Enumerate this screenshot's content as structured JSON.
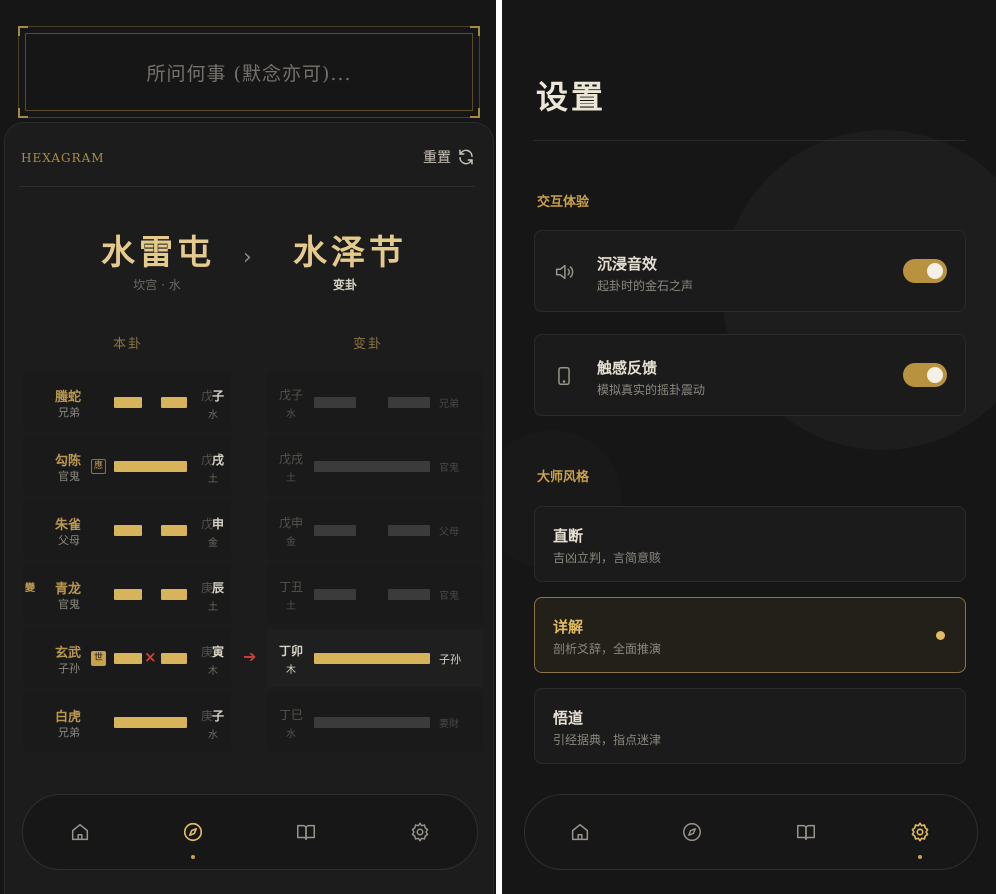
{
  "divination": {
    "question_placeholder": "所问何事 (默念亦可)...",
    "header_label": "HEXAGRAM",
    "reset_label": "重置",
    "original": {
      "name": "水雷屯",
      "palace": "坎宫 · 水",
      "column_title": "本卦"
    },
    "changed": {
      "name": "水泽节",
      "label": "变卦",
      "column_title": "变卦"
    },
    "side_mark": "變",
    "lines": [
      {
        "spirit": "螣蛇",
        "relation": "兄弟",
        "type": "yin",
        "badge": "",
        "naja": "子",
        "naja_prefix": "戊",
        "element": "水",
        "moving": false,
        "changed": {
          "naja": "子",
          "prefix": "戊",
          "element": "水",
          "type": "yin",
          "relation": "兄弟",
          "active": false
        }
      },
      {
        "spirit": "勾陈",
        "relation": "官鬼",
        "type": "yang",
        "badge": "應",
        "naja": "戌",
        "naja_prefix": "戊",
        "element": "土",
        "moving": false,
        "changed": {
          "naja": "戌",
          "prefix": "戊",
          "element": "土",
          "type": "yang",
          "relation": "官鬼",
          "active": false
        }
      },
      {
        "spirit": "朱雀",
        "relation": "父母",
        "type": "yin",
        "badge": "",
        "naja": "申",
        "naja_prefix": "戊",
        "element": "金",
        "moving": false,
        "changed": {
          "naja": "申",
          "prefix": "戊",
          "element": "金",
          "type": "yin",
          "relation": "父母",
          "active": false
        }
      },
      {
        "spirit": "青龙",
        "relation": "官鬼",
        "type": "yin",
        "badge": "",
        "naja": "辰",
        "naja_prefix": "庚",
        "element": "土",
        "moving": false,
        "changed": {
          "naja": "丑",
          "prefix": "丁",
          "element": "土",
          "type": "yin",
          "relation": "官鬼",
          "active": false
        }
      },
      {
        "spirit": "玄武",
        "relation": "子孙",
        "type": "yin",
        "badge": "世",
        "naja": "寅",
        "naja_prefix": "庚",
        "element": "木",
        "moving": true,
        "changed": {
          "naja": "卯",
          "prefix": "丁",
          "element": "木",
          "type": "yang",
          "relation": "子孙",
          "active": true
        }
      },
      {
        "spirit": "白虎",
        "relation": "兄弟",
        "type": "yang",
        "badge": "",
        "naja": "子",
        "naja_prefix": "庚",
        "element": "水",
        "moving": false,
        "changed": {
          "naja": "巳",
          "prefix": "丁",
          "element": "水",
          "type": "yang",
          "relation": "妻財",
          "active": false
        }
      }
    ],
    "nav": [
      {
        "icon": "home-icon",
        "active": false
      },
      {
        "icon": "compass-icon",
        "active": true
      },
      {
        "icon": "book-icon",
        "active": false
      },
      {
        "icon": "gear-icon",
        "active": false
      }
    ]
  },
  "settings": {
    "title": "设置",
    "interaction_section": "交互体验",
    "sound": {
      "title": "沉浸音效",
      "desc": "起卦时的金石之声",
      "enabled": true,
      "icon": "speaker-icon"
    },
    "haptic": {
      "title": "触感反馈",
      "desc": "模拟真实的摇卦震动",
      "enabled": true,
      "icon": "phone-icon"
    },
    "style_section": "大师风格",
    "styles": [
      {
        "title": "直断",
        "desc": "吉凶立判，言简意赅",
        "selected": false
      },
      {
        "title": "详解",
        "desc": "剖析爻辞，全面推演",
        "selected": true
      },
      {
        "title": "悟道",
        "desc": "引经据典，指点迷津",
        "selected": false
      }
    ],
    "nav": [
      {
        "icon": "home-icon",
        "active": false
      },
      {
        "icon": "compass-icon",
        "active": false
      },
      {
        "icon": "book-icon",
        "active": false
      },
      {
        "icon": "gear-icon",
        "active": true
      }
    ],
    "colors": {
      "gold": "#c9a14a",
      "background": "#161616",
      "moving_line": "#c9423a"
    }
  }
}
